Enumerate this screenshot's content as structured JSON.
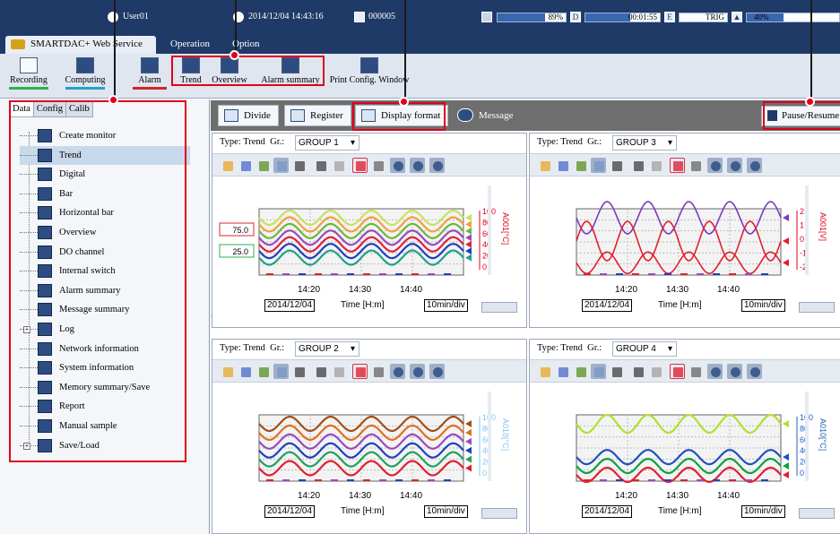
{
  "topbar": {
    "user": "User01",
    "datetime": "2014/12/04 14:43:16",
    "memory_id": "000005",
    "mem_pct": "89%",
    "elapsed": "00:01:55",
    "mode": "TRIG",
    "last_pct": "40%"
  },
  "menu": {
    "service": "SMARTDAC+ Web Service",
    "operation": "Operation",
    "option": "Option"
  },
  "ribbon": [
    {
      "label": "Recording",
      "color": "#2fb14a"
    },
    {
      "label": "Computing",
      "color": "#24a3c4"
    },
    {
      "label": "Alarm",
      "color": "#d0252a"
    },
    {
      "label": "Trend"
    },
    {
      "label": "Overview"
    },
    {
      "label": "Alarm summary"
    },
    {
      "label": "Print Config. Window"
    }
  ],
  "tabs": [
    "Data",
    "Config",
    "Calib"
  ],
  "tree": [
    "Create monitor",
    "Trend",
    "Digital",
    "Bar",
    "Horizontal bar",
    "Overview",
    "DO channel",
    "Internal switch",
    "Alarm summary",
    "Message summary",
    "Log",
    "Network information",
    "System information",
    "Memory summary/Save",
    "Report",
    "Manual sample",
    "Save/Load"
  ],
  "toolbar": {
    "divide": "Divide",
    "register": "Register",
    "display_format": "Display format",
    "message": "Message",
    "pause": "Pause/Resume"
  },
  "graphs": [
    {
      "type_label": "Type: Trend",
      "group_label": "Gr.:",
      "group": "GROUP 1",
      "ticks": [
        "14:20",
        "14:30",
        "14:40"
      ],
      "date": "2014/12/04",
      "time_label": "Time [H:m]",
      "div": "10min/div",
      "scale": [
        "100",
        "80",
        "60",
        "40",
        "20",
        "0"
      ],
      "channel": "A001[°C]",
      "alarm_upper": "75.0",
      "alarm_lower": "25.0",
      "scale_color": "#e0001b"
    },
    {
      "type_label": "Type: Trend",
      "group_label": "Gr.:",
      "group": "GROUP 3",
      "ticks": [
        "14:20",
        "14:30",
        "14:40"
      ],
      "date": "2014/12/04",
      "time_label": "Time [H:m]",
      "div": "10min/div",
      "scale": [
        "2",
        "1",
        "0",
        "-1",
        "-2"
      ],
      "channel": "A001[V]",
      "scale_color": "#e0001b"
    },
    {
      "type_label": "Type: Trend",
      "group_label": "Gr.:",
      "group": "GROUP 2",
      "ticks": [
        "14:20",
        "14:30",
        "14:40"
      ],
      "date": "2014/12/04",
      "time_label": "Time [H:m]",
      "div": "10min/div",
      "scale": [
        "100",
        "80",
        "60",
        "40",
        "20",
        "0"
      ],
      "channel": "A018[°C]",
      "scale_color": "#7fc8f0"
    },
    {
      "type_label": "Type: Trend",
      "group_label": "Gr.:",
      "group": "GROUP 4",
      "ticks": [
        "14:20",
        "14:30",
        "14:40"
      ],
      "date": "2014/12/04",
      "time_label": "Time [H:m]",
      "div": "10min/div",
      "scale": [
        "100",
        "80",
        "60",
        "40",
        "20",
        "0"
      ],
      "channel": "A010[°C]",
      "scale_color": "#2060c0"
    }
  ],
  "icons": [
    "user-icon",
    "clock-icon",
    "memory-icon",
    "play-icon",
    "pause-icon"
  ]
}
